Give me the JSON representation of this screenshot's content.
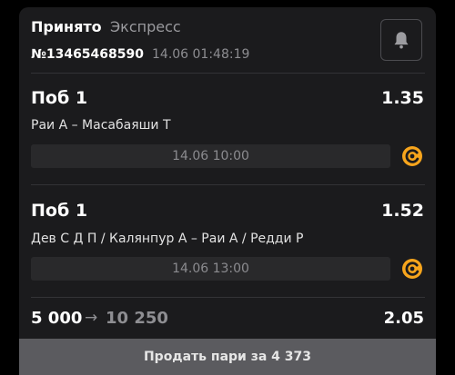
{
  "header": {
    "status": "Принято",
    "bet_type": "Экспресс",
    "bet_number": "№13465468590",
    "bet_time": "14.06 01:48:19",
    "bell_icon": "bell-icon"
  },
  "selections": [
    {
      "outcome": "Поб 1",
      "odds": "1.35",
      "event": "Раи А – Масабаяши Т",
      "start_time": "14.06 10:00",
      "status_icon": "live-icon"
    },
    {
      "outcome": "Поб 1",
      "odds": "1.52",
      "event": "Дев С Д П / Калянпур А – Раи А / Редди Р",
      "start_time": "14.06 13:00",
      "status_icon": "live-icon"
    }
  ],
  "summary": {
    "stake": "5 000",
    "arrow": "→",
    "payout": "10 250",
    "total_odds": "2.05"
  },
  "sell_button": {
    "label": "Продать пари за 4 373"
  },
  "colors": {
    "background": "#000000",
    "card": "#1b1b1d",
    "accent_icon": "#f7a51c",
    "sell_button": "#5b5b5f"
  }
}
